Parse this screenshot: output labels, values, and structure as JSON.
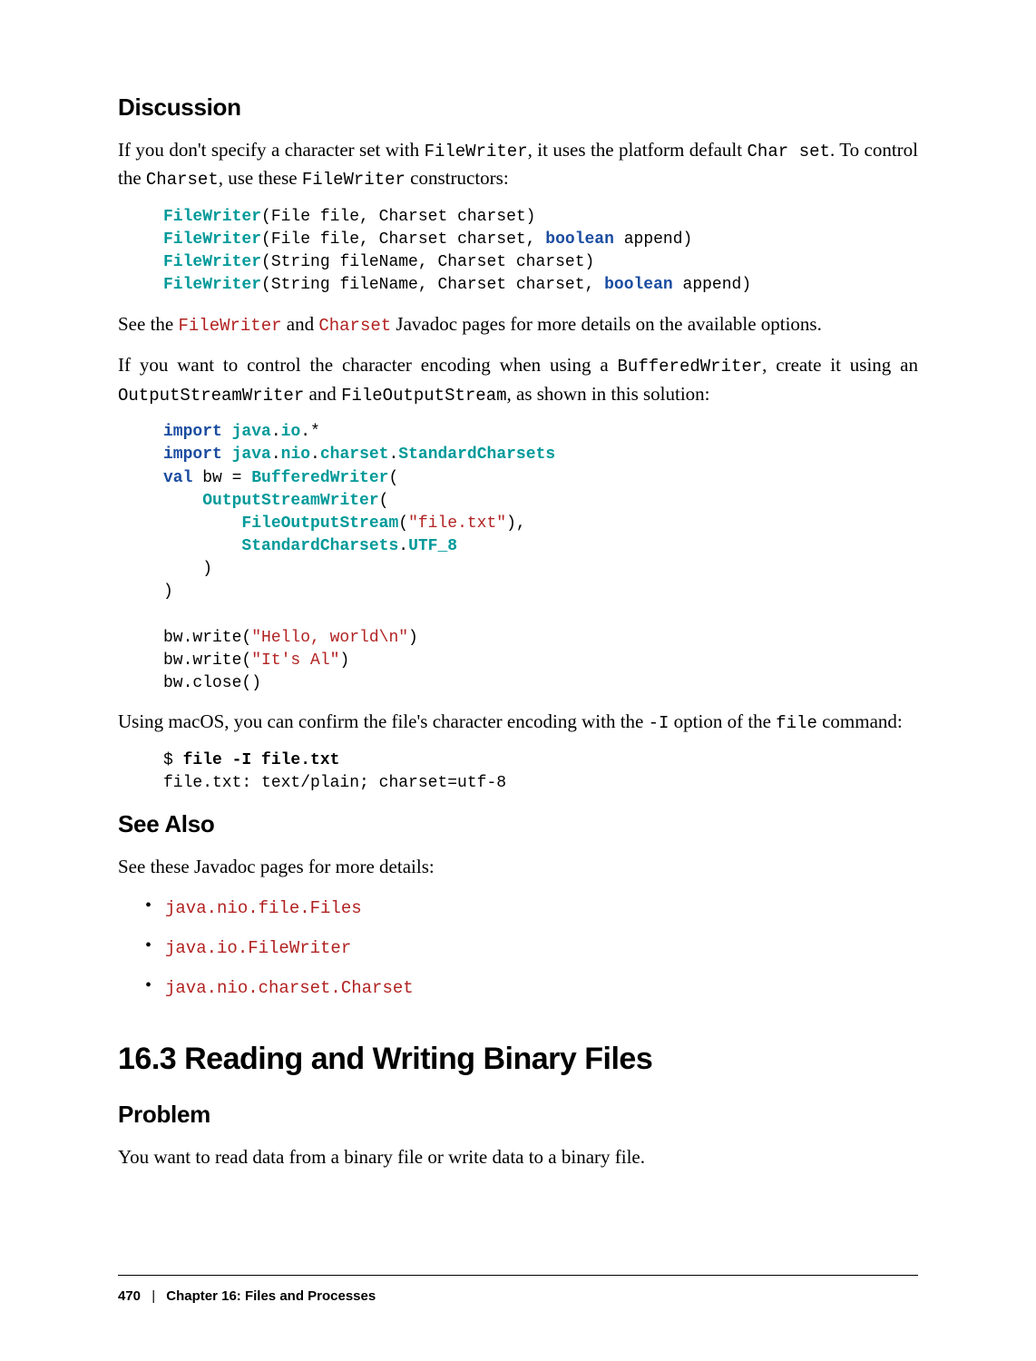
{
  "headings": {
    "discussion": "Discussion",
    "see_also": "See Also",
    "recipe": "16.3 Reading and Writing Binary Files",
    "problem": "Problem"
  },
  "para": {
    "p1a": "If you don't specify a character set with ",
    "p1_code1": "FileWriter",
    "p1b": ", it uses the platform default ",
    "p1_code2": "Char set",
    "p1c": ". To control the ",
    "p1_code3": "Charset",
    "p1d": ", use these ",
    "p1_code4": "FileWriter",
    "p1e": " constructors:",
    "p2a": "See the ",
    "p2_link1": "FileWriter",
    "p2b": " and ",
    "p2_link2": "Charset",
    "p2c": " Javadoc pages for more details on the available options.",
    "p3a": "If you want to control the character encoding when using a ",
    "p3_code1": "BufferedWriter",
    "p3b": ", create it using an ",
    "p3_code2": "OutputStreamWriter",
    "p3c": " and ",
    "p3_code3": "FileOutputStream",
    "p3d": ", as shown in this solution:",
    "p4a": "Using macOS, you can confirm the file's character encoding with the ",
    "p4_code1": "-I",
    "p4b": " option of the ",
    "p4_code2": "file",
    "p4c": " command:",
    "see_also_intro": "See these Javadoc pages for more details:",
    "problem_p": "You want to read data from a binary file or write data to a binary file."
  },
  "code1": {
    "l1a": "FileWriter",
    "l1b": "(File file, Charset charset)",
    "l2a": "FileWriter",
    "l2b": "(File file, Charset charset, ",
    "l2c": "boolean",
    "l2d": " append)",
    "l3a": "FileWriter",
    "l3b": "(String fileName, Charset charset)",
    "l4a": "FileWriter",
    "l4b": "(String fileName, Charset charset, ",
    "l4c": "boolean",
    "l4d": " append)"
  },
  "code2": {
    "l1a": "import",
    "l1b": " java",
    "l1c": ".",
    "l1d": "io",
    "l1e": ".*",
    "l2a": "import",
    "l2b": " java",
    "l2c": ".",
    "l2d": "nio",
    "l2e": ".",
    "l2f": "charset",
    "l2g": ".",
    "l2h": "StandardCharsets",
    "l3a": "val",
    "l3b": " bw = ",
    "l3c": "BufferedWriter",
    "l3d": "(",
    "l4a": "    ",
    "l4b": "OutputStreamWriter",
    "l4c": "(",
    "l5a": "        ",
    "l5b": "FileOutputStream",
    "l5c": "(",
    "l5d": "\"file.txt\"",
    "l5e": "),",
    "l6a": "        ",
    "l6b": "StandardCharsets",
    "l6c": ".",
    "l6d": "UTF_8",
    "l7": "    )",
    "l8": ")",
    "blank": "",
    "l9a": "bw.write(",
    "l9b": "\"Hello, world\\n\"",
    "l9c": ")",
    "l10a": "bw.write(",
    "l10b": "\"It's Al\"",
    "l10c": ")",
    "l11": "bw.close()"
  },
  "code3": {
    "l1a": "$ ",
    "l1b": "file -I file.txt",
    "l2": "file.txt: text/plain; charset=utf-8"
  },
  "links": {
    "files": "java.nio.file.Files",
    "filewriter": "java.io.FileWriter",
    "charset": "java.nio.charset.Charset"
  },
  "footer": {
    "page": "470",
    "sep": "|",
    "chapter": "Chapter 16: Files and Processes"
  }
}
